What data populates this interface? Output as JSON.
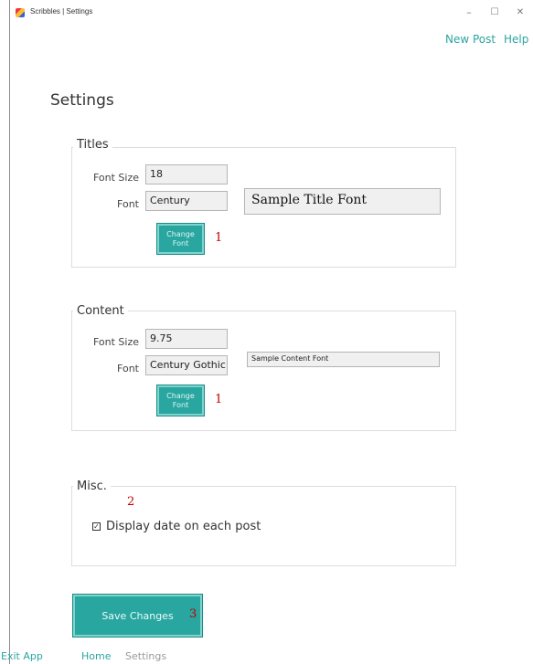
{
  "window": {
    "title": "Scribbles | Settings",
    "minimize": "–",
    "maximize": "☐",
    "close": "✕"
  },
  "menu": {
    "new_post": "New Post",
    "help": "Help"
  },
  "page": {
    "title": "Settings"
  },
  "titles_group": {
    "label": "Titles",
    "font_size_label": "Font Size",
    "font_size_value": "18",
    "font_label": "Font",
    "font_value": "Century",
    "sample_text": "Sample Title Font",
    "change_font_line1": "Change",
    "change_font_line2": "Font",
    "marker": "1"
  },
  "content_group": {
    "label": "Content",
    "font_size_label": "Font Size",
    "font_size_value": "9.75",
    "font_label": "Font",
    "font_value": "Century Gothic",
    "sample_text": "Sample Content Font",
    "change_font_line1": "Change",
    "change_font_line2": "Font",
    "marker": "1"
  },
  "misc_group": {
    "label": "Misc.",
    "marker": "2",
    "display_date_label": "Display date on each post",
    "display_date_checked": true,
    "check_glyph": "✓"
  },
  "save": {
    "label": "Save Changes",
    "marker": "3"
  },
  "bottom_nav": {
    "exit": "Exit App",
    "home": "Home",
    "settings": "Settings"
  },
  "colors": {
    "accent": "#2aa6a0",
    "marker": "#c00000"
  }
}
